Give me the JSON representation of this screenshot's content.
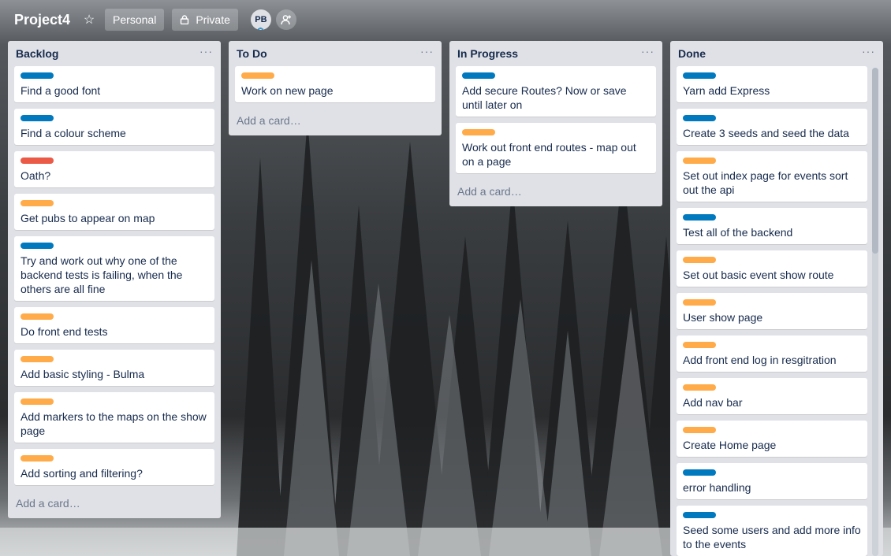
{
  "board": {
    "title": "Project4",
    "personal_label": "Personal",
    "private_label": "Private",
    "avatar_initials": "PB"
  },
  "colors": {
    "blue": "#0079bf",
    "orange": "#ffab4a",
    "red": "#eb5a46"
  },
  "lists": [
    {
      "title": "Backlog",
      "add_card": "Add a card…",
      "cards": [
        {
          "label": "blue",
          "text": "Find a good font"
        },
        {
          "label": "blue",
          "text": "Find a colour scheme"
        },
        {
          "label": "red",
          "text": "Oath?"
        },
        {
          "label": "orange",
          "text": "Get pubs to appear on map"
        },
        {
          "label": "blue",
          "text": "Try and work out why one of the backend tests is failing, when the others are all fine"
        },
        {
          "label": "orange",
          "text": "Do front end tests"
        },
        {
          "label": "orange",
          "text": "Add basic styling - Bulma"
        },
        {
          "label": "orange",
          "text": "Add markers to the maps on the show page"
        },
        {
          "label": "orange",
          "text": "Add sorting and filtering?"
        }
      ]
    },
    {
      "title": "To Do",
      "add_card": "Add a card…",
      "cards": [
        {
          "label": "orange",
          "text": "Work on new page"
        }
      ]
    },
    {
      "title": "In Progress",
      "add_card": "Add a card…",
      "cards": [
        {
          "label": "blue",
          "text": "Add secure Routes? Now or save until later on"
        },
        {
          "label": "orange",
          "text": "Work out front end routes - map out on a page"
        }
      ]
    },
    {
      "title": "Done",
      "cards": [
        {
          "label": "blue",
          "text": "Yarn add Express"
        },
        {
          "label": "blue",
          "text": "Create 3 seeds and seed the data"
        },
        {
          "label": "orange",
          "text": "Set out index page for events sort out the api"
        },
        {
          "label": "blue",
          "text": "Test all of the backend"
        },
        {
          "label": "orange",
          "text": "Set out basic event show route"
        },
        {
          "label": "orange",
          "text": "User show page"
        },
        {
          "label": "orange",
          "text": "Add front end log in resgitration"
        },
        {
          "label": "orange",
          "text": "Add nav bar"
        },
        {
          "label": "orange",
          "text": "Create Home page"
        },
        {
          "label": "blue",
          "text": "error handling"
        },
        {
          "label": "blue",
          "text": "Seed some users and add more info to the events"
        }
      ]
    }
  ]
}
